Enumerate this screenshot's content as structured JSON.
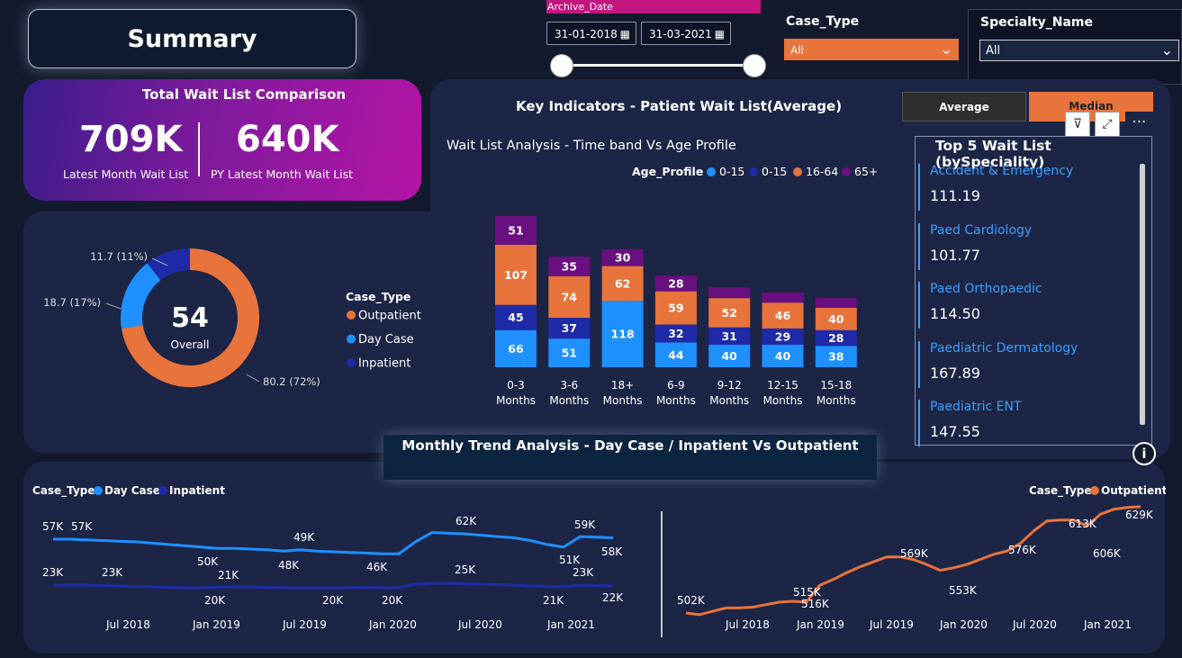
{
  "title": "Summary",
  "archive": {
    "label": "Archive_Date",
    "start": "31-01-2018",
    "end": "31-03-2021"
  },
  "case_type_slicer": {
    "label": "Case_Type",
    "value": "All"
  },
  "specialty_slicer": {
    "label": "Specialty_Name",
    "value": "All"
  },
  "total_wait": {
    "title": "Total Wait  List Comparison",
    "latest_value": "709K",
    "latest_label": "Latest Month Wait List",
    "py_value": "640K",
    "py_label": "PY Latest Month Wait List"
  },
  "key_indicators": {
    "title": "Key Indicators - Patient Wait List(Average)",
    "avg_label": "Average",
    "median_label": "Median"
  },
  "top5": {
    "title": "Top 5 Wait List (bySpeciality)",
    "items": [
      {
        "name": "Accident & Emergency",
        "value": "111.19"
      },
      {
        "name": "Paed Cardiology",
        "value": "101.77"
      },
      {
        "name": "Paed Orthopaedic",
        "value": "114.50"
      },
      {
        "name": "Paediatric Dermatology",
        "value": "167.89"
      },
      {
        "name": "Paediatric ENT",
        "value": "147.55"
      }
    ]
  },
  "monthly_title": "Monthly Trend Analysis - Day Case / Inpatient Vs Outpatient",
  "colors": {
    "orange": "#e8733b",
    "light_blue": "#1e90ff",
    "dark_blue": "#1e2aa8",
    "purple": "#6a0f80",
    "magenta": "#c3167e"
  },
  "chart_data": [
    {
      "type": "pie",
      "center_value": "54",
      "center_label": "Overall",
      "legend_title": "Case_Type",
      "slices": [
        {
          "name": "Outpatient",
          "value": 80.2,
          "pct": "72%",
          "label": "80.2 (72%)",
          "color": "#e8733b"
        },
        {
          "name": "Day Case",
          "value": 18.7,
          "pct": "17%",
          "label": "18.7 (17%)",
          "color": "#1e90ff"
        },
        {
          "name": "Inpatient",
          "value": 11.7,
          "pct": "11%",
          "label": "11.7 (11%)",
          "color": "#1e2aa8"
        }
      ]
    },
    {
      "type": "bar",
      "stacked": true,
      "title": "Wait List Analysis - Time band Vs Age Profile",
      "legend_title": "Age_Profile",
      "categories": [
        "0-3 Months",
        "3-6 Months",
        "18+ Months",
        "6-9 Months",
        "9-12 Months",
        "12-15 Months",
        "15-18 Months"
      ],
      "series": [
        {
          "name": "0-15",
          "color": "#1e90ff",
          "values": [
            66,
            51,
            118,
            44,
            40,
            40,
            38
          ]
        },
        {
          "name": "0-15",
          "color": "#1e2aa8",
          "values": [
            45,
            37,
            0,
            32,
            31,
            29,
            28
          ]
        },
        {
          "name": "16-64",
          "color": "#e8733b",
          "values": [
            107,
            74,
            62,
            59,
            52,
            46,
            40
          ]
        },
        {
          "name": "65+",
          "color": "#6a0f80",
          "values": [
            51,
            35,
            30,
            28,
            0,
            0,
            0
          ]
        }
      ],
      "hidden_top_values": [
        null,
        null,
        null,
        null,
        19,
        18,
        17
      ]
    },
    {
      "type": "line",
      "legend_title": "Case_Type",
      "x_ticks": [
        "Jul 2018",
        "Jan 2019",
        "Jul 2019",
        "Jan 2020",
        "Jul 2020",
        "Jan 2021"
      ],
      "series": [
        {
          "name": "Day Case",
          "color": "#1e90ff",
          "values": [
            57,
            57,
            56.5,
            56,
            55.5,
            55,
            54,
            53,
            52,
            51,
            50,
            50,
            49.5,
            49,
            48,
            49,
            48,
            47.5,
            47,
            46.5,
            46,
            46,
            55,
            62,
            61.5,
            61,
            60,
            59,
            58,
            56,
            53,
            51,
            59,
            58.5,
            58
          ]
        },
        {
          "name": "Inpatient",
          "color": "#1e2aa8",
          "values": [
            23,
            23,
            23,
            22.5,
            22,
            21.5,
            21,
            20.5,
            20,
            20,
            20.5,
            21,
            21,
            20.5,
            20,
            20,
            20,
            20,
            20,
            20.5,
            20,
            20,
            24,
            25,
            25,
            24.5,
            24,
            23.5,
            23,
            22,
            21.5,
            21,
            23,
            22.5,
            22
          ]
        }
      ],
      "labels": [
        "57K",
        "57K",
        "50K",
        "49K",
        "48K",
        "46K",
        "62K",
        "59K",
        "51K",
        "58K",
        "23K",
        "23K",
        "21K",
        "20K",
        "20K",
        "20K",
        "25K",
        "23K",
        "21K",
        "22K"
      ]
    },
    {
      "type": "line",
      "legend_title": "Case_Type",
      "x_ticks": [
        "Jul 2018",
        "Jan 2019",
        "Jul 2019",
        "Jan 2020",
        "Jul 2020",
        "Jan 2021"
      ],
      "series": [
        {
          "name": "Outpatient",
          "color": "#e8733b",
          "values": [
            502,
            500,
            504,
            508,
            508,
            509,
            512,
            515,
            516,
            515,
            535,
            542,
            550,
            557,
            563,
            569,
            569,
            566,
            560,
            553,
            556,
            560,
            566,
            572,
            576,
            585,
            600,
            612,
            613,
            613,
            606,
            620,
            626,
            628,
            629
          ]
        }
      ],
      "labels": [
        "502K",
        "515K",
        "516K",
        "569K",
        "553K",
        "576K",
        "613K",
        "606K",
        "629K"
      ]
    }
  ]
}
